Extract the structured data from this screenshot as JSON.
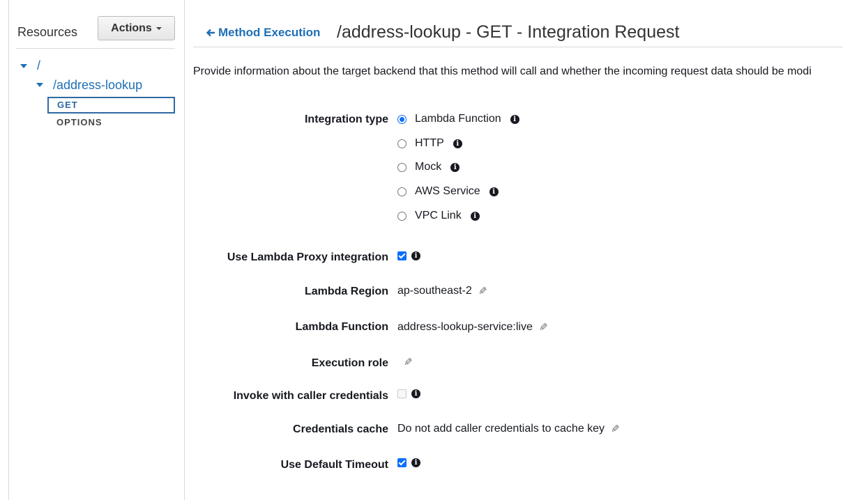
{
  "sidebar": {
    "title": "Resources",
    "actions_label": "Actions",
    "tree": {
      "root": "/",
      "child": "/address-lookup",
      "methods": [
        "GET",
        "OPTIONS"
      ]
    }
  },
  "header": {
    "back_label": "Method Execution",
    "title": "/address-lookup - GET - Integration Request"
  },
  "description": "Provide information about the target backend that this method will call and whether the incoming request data should be modi",
  "form": {
    "integration_type": {
      "label": "Integration type",
      "options": [
        "Lambda Function",
        "HTTP",
        "Mock",
        "AWS Service",
        "VPC Link"
      ],
      "selected": "Lambda Function"
    },
    "proxy": {
      "label": "Use Lambda Proxy integration",
      "checked": true
    },
    "region": {
      "label": "Lambda Region",
      "value": "ap-southeast-2"
    },
    "function": {
      "label": "Lambda Function",
      "value": "address-lookup-service:live"
    },
    "role": {
      "label": "Execution role",
      "value": ""
    },
    "caller_credentials": {
      "label": "Invoke with caller credentials",
      "checked": false
    },
    "credentials_cache": {
      "label": "Credentials cache",
      "value": "Do not add caller credentials to cache key"
    },
    "default_timeout": {
      "label": "Use Default Timeout",
      "checked": true
    }
  },
  "colors": {
    "link": "#1f6fb6",
    "accent": "#0d6efd"
  },
  "icons": [
    "caret-down-icon",
    "arrow-left-icon",
    "info-icon",
    "pencil-icon"
  ]
}
